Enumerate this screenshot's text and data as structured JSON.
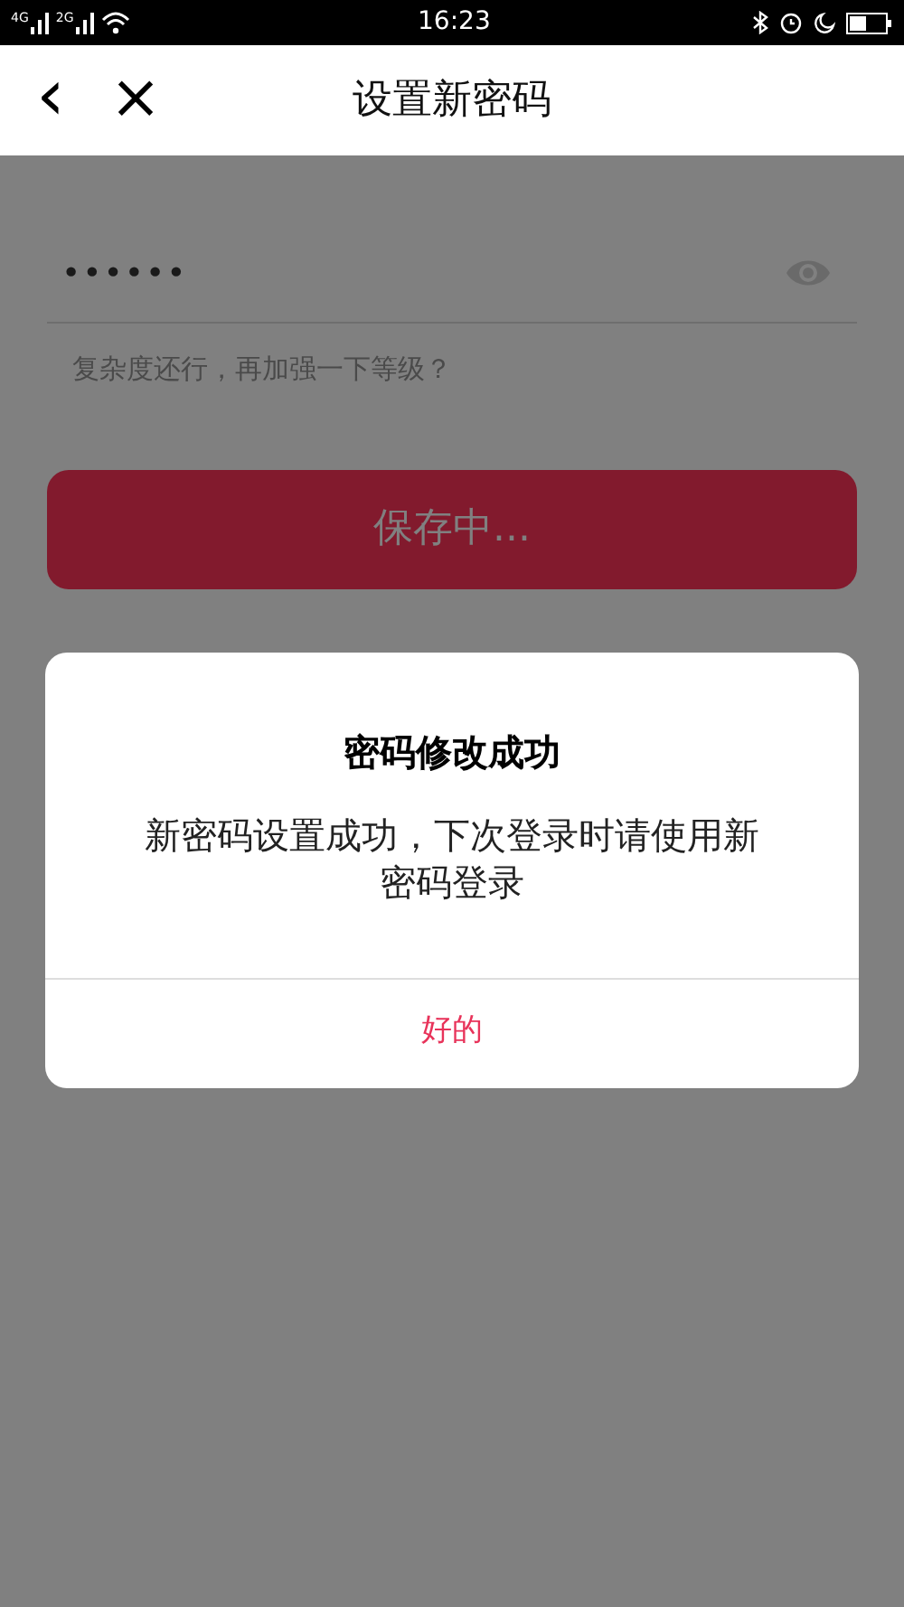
{
  "status_bar": {
    "networks": [
      "4G",
      "2G"
    ],
    "time": "16:23"
  },
  "header": {
    "back": "‹",
    "close": "×",
    "title": "设置新密码"
  },
  "password_field": {
    "value": "••••••",
    "masked": true
  },
  "hint": "复杂度还行，再加强一下等级？",
  "save_button": {
    "label": "保存中..."
  },
  "dialog": {
    "title": "密码修改成功",
    "message": "新密码设置成功，下次登录时请使用新密码登录",
    "ok_button": "好的"
  }
}
